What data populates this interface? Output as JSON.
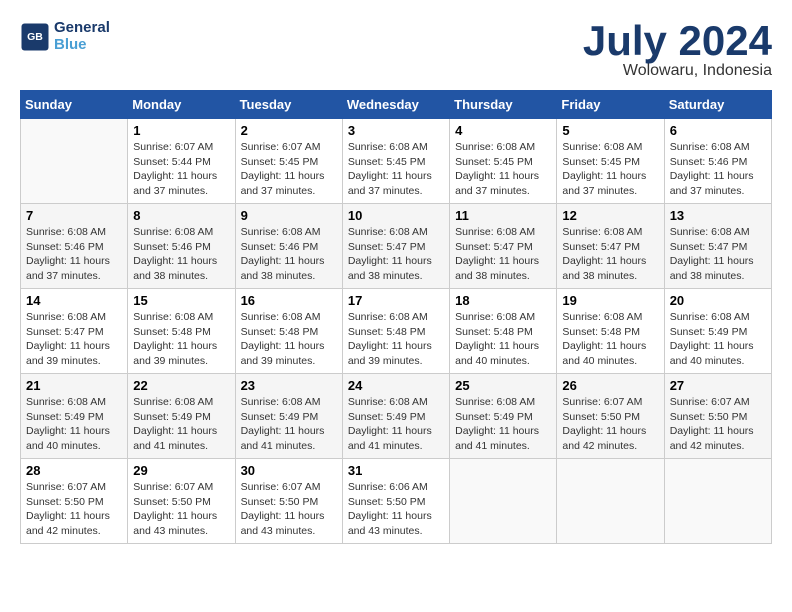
{
  "header": {
    "logo_line1": "General",
    "logo_line2": "Blue",
    "month": "July 2024",
    "location": "Wolowaru, Indonesia"
  },
  "days_of_week": [
    "Sunday",
    "Monday",
    "Tuesday",
    "Wednesday",
    "Thursday",
    "Friday",
    "Saturday"
  ],
  "weeks": [
    [
      {
        "day": "",
        "info": ""
      },
      {
        "day": "1",
        "info": "Sunrise: 6:07 AM\nSunset: 5:44 PM\nDaylight: 11 hours\nand 37 minutes."
      },
      {
        "day": "2",
        "info": "Sunrise: 6:07 AM\nSunset: 5:45 PM\nDaylight: 11 hours\nand 37 minutes."
      },
      {
        "day": "3",
        "info": "Sunrise: 6:08 AM\nSunset: 5:45 PM\nDaylight: 11 hours\nand 37 minutes."
      },
      {
        "day": "4",
        "info": "Sunrise: 6:08 AM\nSunset: 5:45 PM\nDaylight: 11 hours\nand 37 minutes."
      },
      {
        "day": "5",
        "info": "Sunrise: 6:08 AM\nSunset: 5:45 PM\nDaylight: 11 hours\nand 37 minutes."
      },
      {
        "day": "6",
        "info": "Sunrise: 6:08 AM\nSunset: 5:46 PM\nDaylight: 11 hours\nand 37 minutes."
      }
    ],
    [
      {
        "day": "7",
        "info": "Sunrise: 6:08 AM\nSunset: 5:46 PM\nDaylight: 11 hours\nand 37 minutes."
      },
      {
        "day": "8",
        "info": "Sunrise: 6:08 AM\nSunset: 5:46 PM\nDaylight: 11 hours\nand 38 minutes."
      },
      {
        "day": "9",
        "info": "Sunrise: 6:08 AM\nSunset: 5:46 PM\nDaylight: 11 hours\nand 38 minutes."
      },
      {
        "day": "10",
        "info": "Sunrise: 6:08 AM\nSunset: 5:47 PM\nDaylight: 11 hours\nand 38 minutes."
      },
      {
        "day": "11",
        "info": "Sunrise: 6:08 AM\nSunset: 5:47 PM\nDaylight: 11 hours\nand 38 minutes."
      },
      {
        "day": "12",
        "info": "Sunrise: 6:08 AM\nSunset: 5:47 PM\nDaylight: 11 hours\nand 38 minutes."
      },
      {
        "day": "13",
        "info": "Sunrise: 6:08 AM\nSunset: 5:47 PM\nDaylight: 11 hours\nand 38 minutes."
      }
    ],
    [
      {
        "day": "14",
        "info": "Sunrise: 6:08 AM\nSunset: 5:47 PM\nDaylight: 11 hours\nand 39 minutes."
      },
      {
        "day": "15",
        "info": "Sunrise: 6:08 AM\nSunset: 5:48 PM\nDaylight: 11 hours\nand 39 minutes."
      },
      {
        "day": "16",
        "info": "Sunrise: 6:08 AM\nSunset: 5:48 PM\nDaylight: 11 hours\nand 39 minutes."
      },
      {
        "day": "17",
        "info": "Sunrise: 6:08 AM\nSunset: 5:48 PM\nDaylight: 11 hours\nand 39 minutes."
      },
      {
        "day": "18",
        "info": "Sunrise: 6:08 AM\nSunset: 5:48 PM\nDaylight: 11 hours\nand 40 minutes."
      },
      {
        "day": "19",
        "info": "Sunrise: 6:08 AM\nSunset: 5:48 PM\nDaylight: 11 hours\nand 40 minutes."
      },
      {
        "day": "20",
        "info": "Sunrise: 6:08 AM\nSunset: 5:49 PM\nDaylight: 11 hours\nand 40 minutes."
      }
    ],
    [
      {
        "day": "21",
        "info": "Sunrise: 6:08 AM\nSunset: 5:49 PM\nDaylight: 11 hours\nand 40 minutes."
      },
      {
        "day": "22",
        "info": "Sunrise: 6:08 AM\nSunset: 5:49 PM\nDaylight: 11 hours\nand 41 minutes."
      },
      {
        "day": "23",
        "info": "Sunrise: 6:08 AM\nSunset: 5:49 PM\nDaylight: 11 hours\nand 41 minutes."
      },
      {
        "day": "24",
        "info": "Sunrise: 6:08 AM\nSunset: 5:49 PM\nDaylight: 11 hours\nand 41 minutes."
      },
      {
        "day": "25",
        "info": "Sunrise: 6:08 AM\nSunset: 5:49 PM\nDaylight: 11 hours\nand 41 minutes."
      },
      {
        "day": "26",
        "info": "Sunrise: 6:07 AM\nSunset: 5:50 PM\nDaylight: 11 hours\nand 42 minutes."
      },
      {
        "day": "27",
        "info": "Sunrise: 6:07 AM\nSunset: 5:50 PM\nDaylight: 11 hours\nand 42 minutes."
      }
    ],
    [
      {
        "day": "28",
        "info": "Sunrise: 6:07 AM\nSunset: 5:50 PM\nDaylight: 11 hours\nand 42 minutes."
      },
      {
        "day": "29",
        "info": "Sunrise: 6:07 AM\nSunset: 5:50 PM\nDaylight: 11 hours\nand 43 minutes."
      },
      {
        "day": "30",
        "info": "Sunrise: 6:07 AM\nSunset: 5:50 PM\nDaylight: 11 hours\nand 43 minutes."
      },
      {
        "day": "31",
        "info": "Sunrise: 6:06 AM\nSunset: 5:50 PM\nDaylight: 11 hours\nand 43 minutes."
      },
      {
        "day": "",
        "info": ""
      },
      {
        "day": "",
        "info": ""
      },
      {
        "day": "",
        "info": ""
      }
    ]
  ]
}
